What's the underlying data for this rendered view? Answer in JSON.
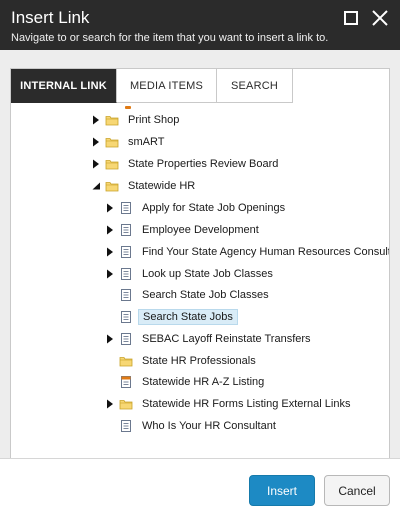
{
  "dialog": {
    "title": "Insert Link",
    "subtitle": "Navigate to or search for the item that you want to insert a link to."
  },
  "tabs": [
    {
      "label": "INTERNAL LINK",
      "active": true
    },
    {
      "label": "MEDIA ITEMS",
      "active": false
    },
    {
      "label": "SEARCH",
      "active": false
    }
  ],
  "tree": {
    "items": [
      {
        "label": "Print Shop",
        "icon": "folder-icon",
        "arrow": "collapsed"
      },
      {
        "label": "smART",
        "icon": "folder-icon",
        "arrow": "collapsed"
      },
      {
        "label": "State Properties Review Board",
        "icon": "folder-icon",
        "arrow": "collapsed"
      },
      {
        "label": "Statewide HR",
        "icon": "folder-icon",
        "arrow": "expanded"
      },
      {
        "label": "Apply for State Job Openings",
        "icon": "document-icon",
        "arrow": "collapsed"
      },
      {
        "label": "Employee Development",
        "icon": "document-icon",
        "arrow": "collapsed"
      },
      {
        "label": "Find Your State Agency Human Resources Consultant",
        "icon": "document-icon",
        "arrow": "collapsed"
      },
      {
        "label": "Look up State Job Classes",
        "icon": "document-icon",
        "arrow": "collapsed"
      },
      {
        "label": "Search State Job Classes",
        "icon": "document-icon",
        "arrow": "none"
      },
      {
        "label": "Search State Jobs",
        "icon": "document-icon",
        "arrow": "none",
        "selected": true
      },
      {
        "label": "SEBAC Layoff Reinstate Transfers",
        "icon": "document-icon",
        "arrow": "collapsed"
      },
      {
        "label": "State HR Professionals",
        "icon": "folder-icon",
        "arrow": "none"
      },
      {
        "label": "Statewide HR A-Z Listing",
        "icon": "list-document-icon",
        "arrow": "none"
      },
      {
        "label": "Statewide HR Forms Listing External Links",
        "icon": "folder-icon",
        "arrow": "collapsed"
      },
      {
        "label": "Who Is Your HR Consultant",
        "icon": "document-icon",
        "arrow": "none"
      }
    ]
  },
  "buttons": {
    "insert": "Insert",
    "cancel": "Cancel"
  },
  "colors": {
    "titlebar": "#2b2b2b",
    "accent": "#1d8ac4",
    "selection": "#d9ecf7",
    "folder": "#f2c94c"
  }
}
